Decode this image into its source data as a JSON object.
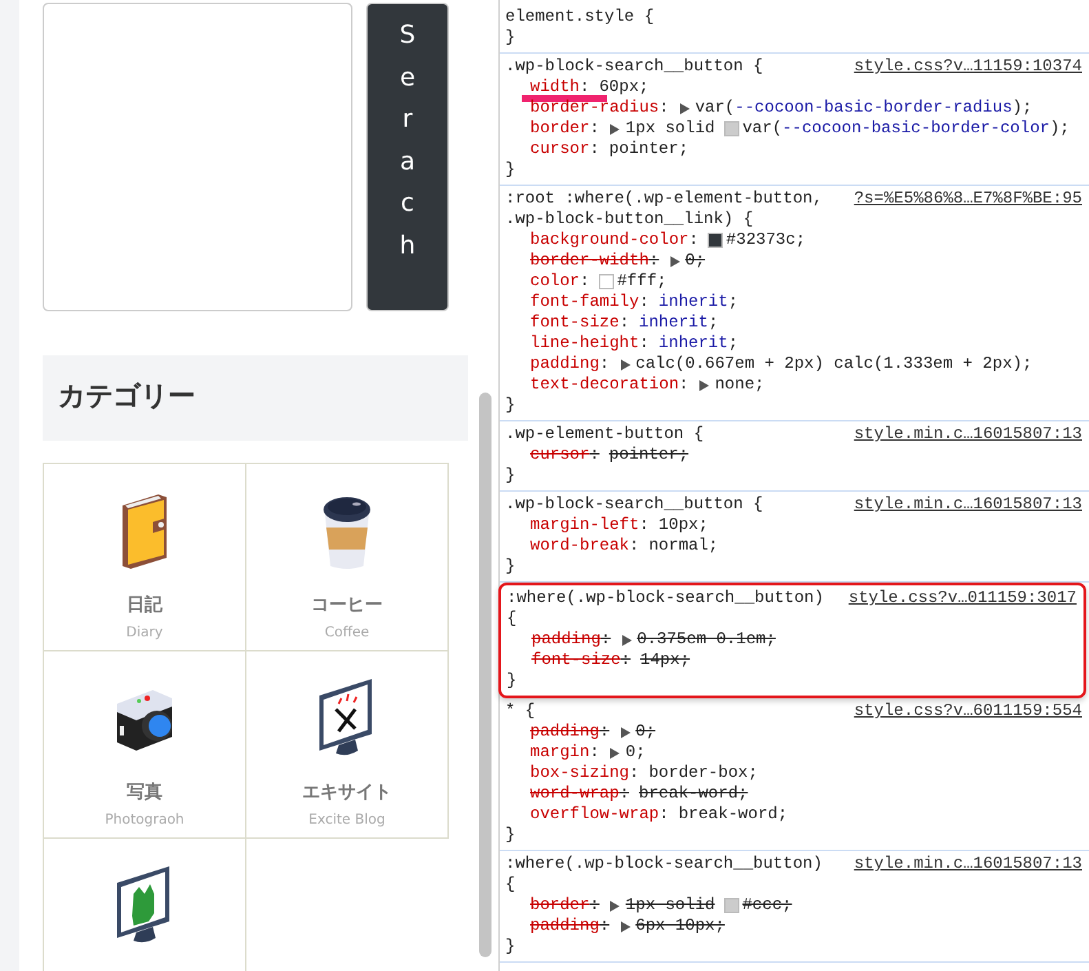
{
  "search_widget": {
    "button_label": "Serach"
  },
  "category_widget": {
    "heading": "カテゴリー",
    "items": [
      {
        "kind": "notebook",
        "title": "日記",
        "subtitle": "Diary"
      },
      {
        "kind": "cup",
        "title": "コーヒー",
        "subtitle": "Coffee"
      },
      {
        "kind": "camera",
        "title": "写真",
        "subtitle": "Photograoh"
      },
      {
        "kind": "monitor-x",
        "title": "エキサイト",
        "subtitle": "Excite Blog"
      },
      {
        "kind": "monitor-green"
      }
    ]
  },
  "styles_pane": {
    "rules": [
      {
        "selector_lines": [
          "element.style {"
        ],
        "closing": "}"
      },
      {
        "selector_lines": [
          ".wp-block-search__button {"
        ],
        "source": "style.css?v…11159:10374",
        "closing": "}",
        "declarations": [
          {
            "property": "width",
            "colon": ":",
            "value": [
              {
                "text": "60px;",
                "kind": "plain"
              }
            ],
            "struck": false,
            "expandable": false,
            "annotated": true
          },
          {
            "property": "border-radius",
            "colon": ":",
            "value": [
              {
                "text": "var(",
                "kind": "plain"
              },
              {
                "text": "--cocoon-basic-border-radius",
                "kind": "keyword"
              },
              {
                "text": ");",
                "kind": "plain"
              }
            ],
            "struck": false,
            "expandable": true,
            "annotated": false
          },
          {
            "property": "border",
            "colon": ":",
            "value": [
              {
                "text": "1px solid",
                "kind": "plain"
              },
              {
                "text": "var(",
                "kind": "plain",
                "color": "#cccccc"
              },
              {
                "text": "--cocoon-basic-border-color",
                "kind": "keyword"
              },
              {
                "text": ");",
                "kind": "plain"
              }
            ],
            "struck": false,
            "expandable": true,
            "annotated": false
          },
          {
            "property": "cursor",
            "colon": ":",
            "value": [
              {
                "text": "pointer;",
                "kind": "plain"
              }
            ],
            "struck": false,
            "expandable": false,
            "annotated": false
          }
        ]
      },
      {
        "selector_lines": [
          ":root :where(.wp-element-button,",
          ".wp-block-button__link) {"
        ],
        "source": "?s=%E5%86%8…E7%8F%BE:95",
        "closing": "}",
        "declarations": [
          {
            "property": "background-color",
            "colon": ":",
            "value": [
              {
                "text": "#32373c;",
                "kind": "plain",
                "color": "#32373c"
              }
            ],
            "struck": false,
            "expandable": false,
            "annotated": false
          },
          {
            "property": "border-width",
            "colon": ":",
            "value": [
              {
                "text": "0;",
                "kind": "plain"
              }
            ],
            "struck": true,
            "expandable": true,
            "annotated": false
          },
          {
            "property": "color",
            "colon": ":",
            "value": [
              {
                "text": "#fff;",
                "kind": "plain",
                "color": "#ffffff"
              }
            ],
            "struck": false,
            "expandable": false,
            "annotated": false
          },
          {
            "property": "font-family",
            "colon": ":",
            "value": [
              {
                "text": "inherit",
                "kind": "keyword"
              },
              {
                "text": ";",
                "kind": "plain"
              }
            ],
            "struck": false,
            "expandable": false,
            "annotated": false
          },
          {
            "property": "font-size",
            "colon": ":",
            "value": [
              {
                "text": "inherit",
                "kind": "keyword"
              },
              {
                "text": ";",
                "kind": "plain"
              }
            ],
            "struck": false,
            "expandable": false,
            "annotated": false
          },
          {
            "property": "line-height",
            "colon": ":",
            "value": [
              {
                "text": "inherit",
                "kind": "keyword"
              },
              {
                "text": ";",
                "kind": "plain"
              }
            ],
            "struck": false,
            "expandable": false,
            "annotated": false
          },
          {
            "property": "padding",
            "colon": ":",
            "value": [
              {
                "text": "calc(0.667em + 2px) calc(1.333em + 2px);",
                "kind": "plain"
              }
            ],
            "struck": false,
            "expandable": true,
            "annotated": false
          },
          {
            "property": "text-decoration",
            "colon": ":",
            "value": [
              {
                "text": "none;",
                "kind": "plain"
              }
            ],
            "struck": false,
            "expandable": true,
            "annotated": false
          }
        ]
      },
      {
        "selector_lines": [
          ".wp-element-button {"
        ],
        "source": "style.min.c…16015807:13",
        "closing": "}",
        "declarations": [
          {
            "property": "cursor",
            "colon": ":",
            "value": [
              {
                "text": "pointer;",
                "kind": "plain"
              }
            ],
            "struck": true,
            "expandable": false,
            "annotated": false
          }
        ]
      },
      {
        "selector_lines": [
          ".wp-block-search__button {"
        ],
        "source": "style.min.c…16015807:13",
        "closing": "}",
        "declarations": [
          {
            "property": "margin-left",
            "colon": ":",
            "value": [
              {
                "text": "10px;",
                "kind": "plain"
              }
            ],
            "struck": false,
            "expandable": false,
            "annotated": false
          },
          {
            "property": "word-break",
            "colon": ":",
            "value": [
              {
                "text": "normal;",
                "kind": "plain"
              }
            ],
            "struck": false,
            "expandable": false,
            "annotated": false
          }
        ]
      },
      {
        "selector_lines": [
          ":where(.wp-block-search__button)",
          "{"
        ],
        "source": "style.css?v…011159:3017",
        "highlighted": true,
        "closing": "}",
        "declarations": [
          {
            "property": "padding",
            "colon": ":",
            "value": [
              {
                "text": "0.375em 0.1em;",
                "kind": "plain"
              }
            ],
            "struck": true,
            "expandable": true,
            "annotated": false
          },
          {
            "property": "font-size",
            "colon": ":",
            "value": [
              {
                "text": "14px;",
                "kind": "plain"
              }
            ],
            "struck": true,
            "expandable": false,
            "annotated": false
          }
        ]
      },
      {
        "selector_lines": [
          "* {"
        ],
        "source": "style.css?v…6011159:554",
        "closing": "}",
        "declarations": [
          {
            "property": "padding",
            "colon": ":",
            "value": [
              {
                "text": "0;",
                "kind": "plain"
              }
            ],
            "struck": true,
            "expandable": true,
            "annotated": false
          },
          {
            "property": "margin",
            "colon": ":",
            "value": [
              {
                "text": "0;",
                "kind": "plain"
              }
            ],
            "struck": false,
            "expandable": true,
            "annotated": false
          },
          {
            "property": "box-sizing",
            "colon": ":",
            "value": [
              {
                "text": "border-box;",
                "kind": "plain"
              }
            ],
            "struck": false,
            "expandable": false,
            "annotated": false
          },
          {
            "property": "word-wrap",
            "colon": ":",
            "value": [
              {
                "text": "break-word;",
                "kind": "plain"
              }
            ],
            "struck": true,
            "expandable": false,
            "annotated": false
          },
          {
            "property": "overflow-wrap",
            "colon": ":",
            "value": [
              {
                "text": "break-word;",
                "kind": "plain"
              }
            ],
            "struck": false,
            "expandable": false,
            "annotated": false
          }
        ]
      },
      {
        "selector_lines": [
          ":where(.wp-block-search__button)",
          "{"
        ],
        "source": "style.min.c…16015807:13",
        "closing": "}",
        "declarations": [
          {
            "property": "border",
            "colon": ":",
            "value": [
              {
                "text": "1px solid",
                "kind": "plain"
              },
              {
                "text": "#ccc;",
                "kind": "plain",
                "color": "#cccccc"
              }
            ],
            "struck": true,
            "expandable": true,
            "annotated": false
          },
          {
            "property": "padding",
            "colon": ":",
            "value": [
              {
                "text": "6px 10px;",
                "kind": "plain"
              }
            ],
            "struck": true,
            "expandable": true,
            "annotated": false
          }
        ]
      }
    ]
  }
}
